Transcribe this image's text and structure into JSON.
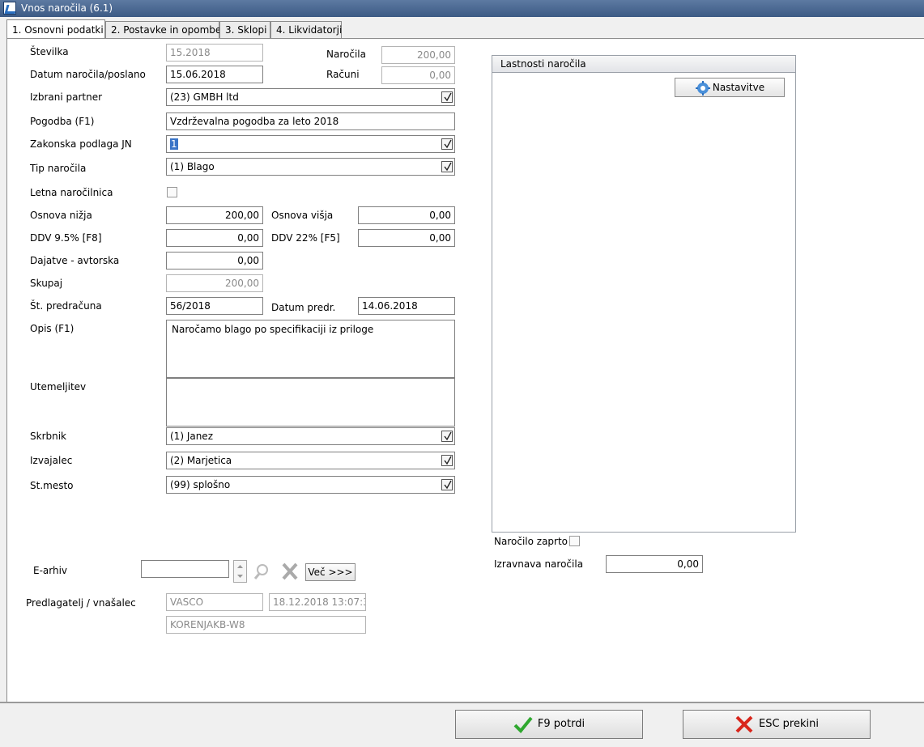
{
  "window": {
    "title": "Vnos naročila  (6.1)"
  },
  "tabs": [
    {
      "label": "1. Osnovni podatki"
    },
    {
      "label": "2. Postavke in opombe"
    },
    {
      "label": "3. Sklopi"
    },
    {
      "label": "4. Likvidatorji"
    }
  ],
  "form": {
    "stevilka": {
      "label": "Številka",
      "value": "15.2018"
    },
    "datum": {
      "label": "Datum naročila/poslano",
      "value": "15.06.2018"
    },
    "narocila": {
      "label": "Naročila",
      "value": "200,00"
    },
    "racuni": {
      "label": "Računi",
      "value": "0,00"
    },
    "partner": {
      "label": "Izbrani partner",
      "value": "(23) GMBH ltd"
    },
    "pogodba": {
      "label": "Pogodba (F1)",
      "value": "Vzdrževalna pogodba za leto 2018"
    },
    "podlaga": {
      "label": "Zakonska podlaga JN",
      "value": "1"
    },
    "tip": {
      "label": "Tip naročila",
      "value": "(1) Blago"
    },
    "letna": {
      "label": "Letna naročilnica"
    },
    "osnova_nizja": {
      "label": "Osnova nižja",
      "value": "200,00"
    },
    "osnova_visja": {
      "label": "Osnova višja",
      "value": "0,00"
    },
    "ddv95": {
      "label": "DDV 9.5% [F8]",
      "value": "0,00"
    },
    "ddv22": {
      "label": "DDV 22% [F5]",
      "value": "0,00"
    },
    "dajatve": {
      "label": "Dajatve - avtorska",
      "value": "0,00"
    },
    "skupaj": {
      "label": "Skupaj",
      "value": "200,00"
    },
    "predracun": {
      "label": "Št. predračuna",
      "value": "56/2018"
    },
    "datum_predr": {
      "label": "Datum predr.",
      "value": "14.06.2018"
    },
    "opis": {
      "label": "Opis (F1)",
      "value": "Naročamo blago po specifikaciji iz priloge"
    },
    "utemeljitev": {
      "label": "Utemeljitev",
      "value": ""
    },
    "skrbnik": {
      "label": "Skrbnik",
      "value": "(1) Janez"
    },
    "izvajalec": {
      "label": "Izvajalec",
      "value": "(2) Marjetica"
    },
    "stmesto": {
      "label": "St.mesto",
      "value": "(99) splošno"
    },
    "earhiv": {
      "label": "E-arhiv",
      "value": "",
      "more_label": "Več >>>"
    },
    "predlagatelj": {
      "label": "Predlagatelj / vnašalec",
      "user": "VASCO",
      "timestamp": "18.12.2018 13:07:3",
      "host": "KORENJAKB-W8"
    }
  },
  "properties": {
    "title": "Lastnosti naročila",
    "settings_label": "Nastavitve",
    "zaprto_label": "Naročilo zaprto",
    "izravnava_label": "Izravnava naročila",
    "izravnava_value": "0,00"
  },
  "footer": {
    "confirm_label": "F9 potrdi",
    "cancel_label": "ESC prekini"
  },
  "colors": {
    "titlebar": "#4a6a96",
    "selection": "#3a74c7",
    "confirm_icon": "#2fa82f",
    "cancel_icon": "#d9261c"
  }
}
